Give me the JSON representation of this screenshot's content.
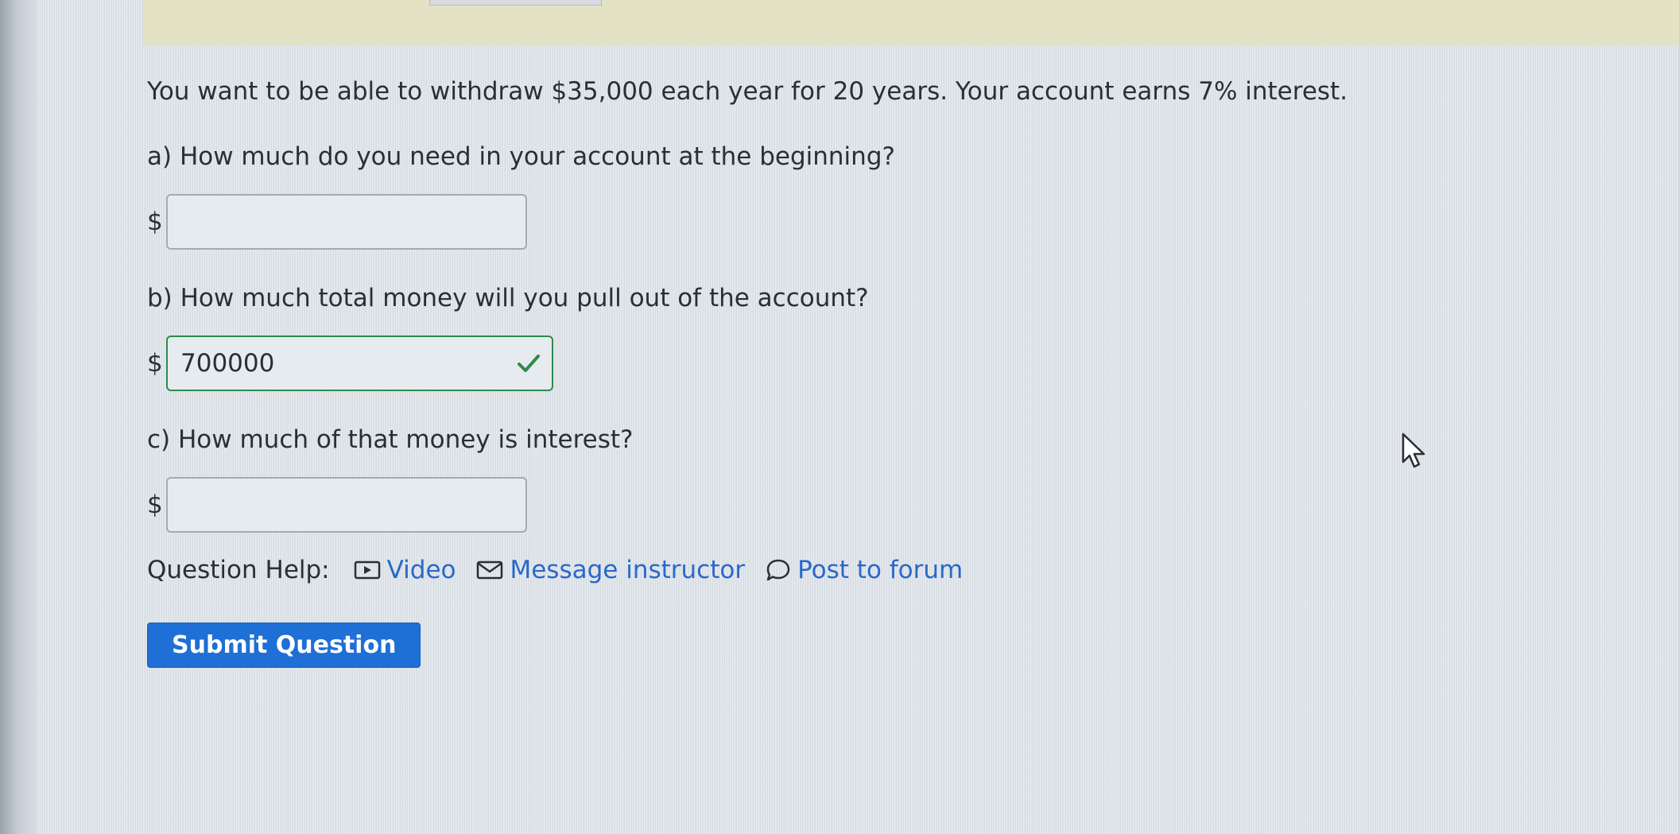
{
  "problem": {
    "prompt": "You want to be able to withdraw $35,000 each year for 20 years. Your account earns 7% interest."
  },
  "questions": [
    {
      "label": "a) How much do you need in your account at the beginning?",
      "currency": "$",
      "value": ""
    },
    {
      "label": "b) How much total money will you pull out of the account?",
      "currency": "$",
      "value": "700000",
      "status": "correct"
    },
    {
      "label": "c) How much of that money is interest?",
      "currency": "$",
      "value": ""
    }
  ],
  "help": {
    "label": "Question Help:",
    "video": {
      "label": "Video",
      "icon": "video-icon"
    },
    "message": {
      "label": "Message instructor",
      "icon": "envelope-icon"
    },
    "forum": {
      "label": "Post to forum",
      "icon": "speech-bubble-icon"
    }
  },
  "submit": {
    "label": "Submit Question"
  },
  "colors": {
    "link": "#2a68c9",
    "button": "#1e6fd6",
    "correct": "#2f8a4a",
    "banner": "#e3e2c4"
  }
}
